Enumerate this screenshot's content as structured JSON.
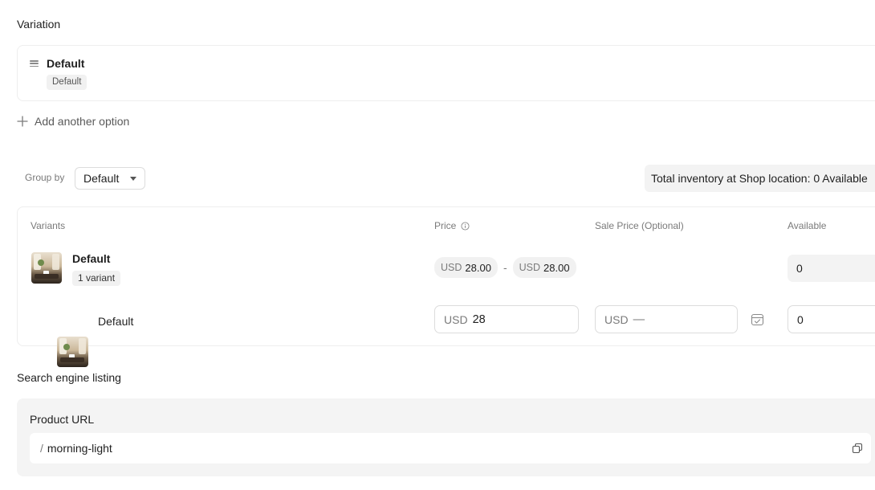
{
  "variation": {
    "title": "Variation",
    "option_name": "Default",
    "option_values": [
      "Default"
    ],
    "add_option_label": "Add another option"
  },
  "group_by": {
    "label": "Group by",
    "selected": "Default"
  },
  "inventory": {
    "summary": "Total inventory at Shop location: 0 Available"
  },
  "variants_table": {
    "headers": {
      "variants": "Variants",
      "price": "Price",
      "sale_price": "Sale Price (Optional)",
      "available": "Available"
    },
    "group_row": {
      "name": "Default",
      "count_badge": "1 variant",
      "price_min_currency": "USD",
      "price_min": "28.00",
      "separator": "-",
      "price_max_currency": "USD",
      "price_max": "28.00",
      "available": "0"
    },
    "variant_row": {
      "name": "Default",
      "price_currency": "USD",
      "price": "28",
      "sale_currency": "USD",
      "sale_value": "—",
      "available": "0"
    }
  },
  "seo": {
    "title": "Search engine listing",
    "url_label": "Product URL",
    "url_prefix": "/",
    "url_slug": "morning-light"
  },
  "icons": {
    "drag": "drag-handle-icon",
    "plus": "plus-icon",
    "info": "info-icon",
    "calendar": "calendar-icon",
    "copy": "copy-icon",
    "caret": "caret-down-icon"
  }
}
